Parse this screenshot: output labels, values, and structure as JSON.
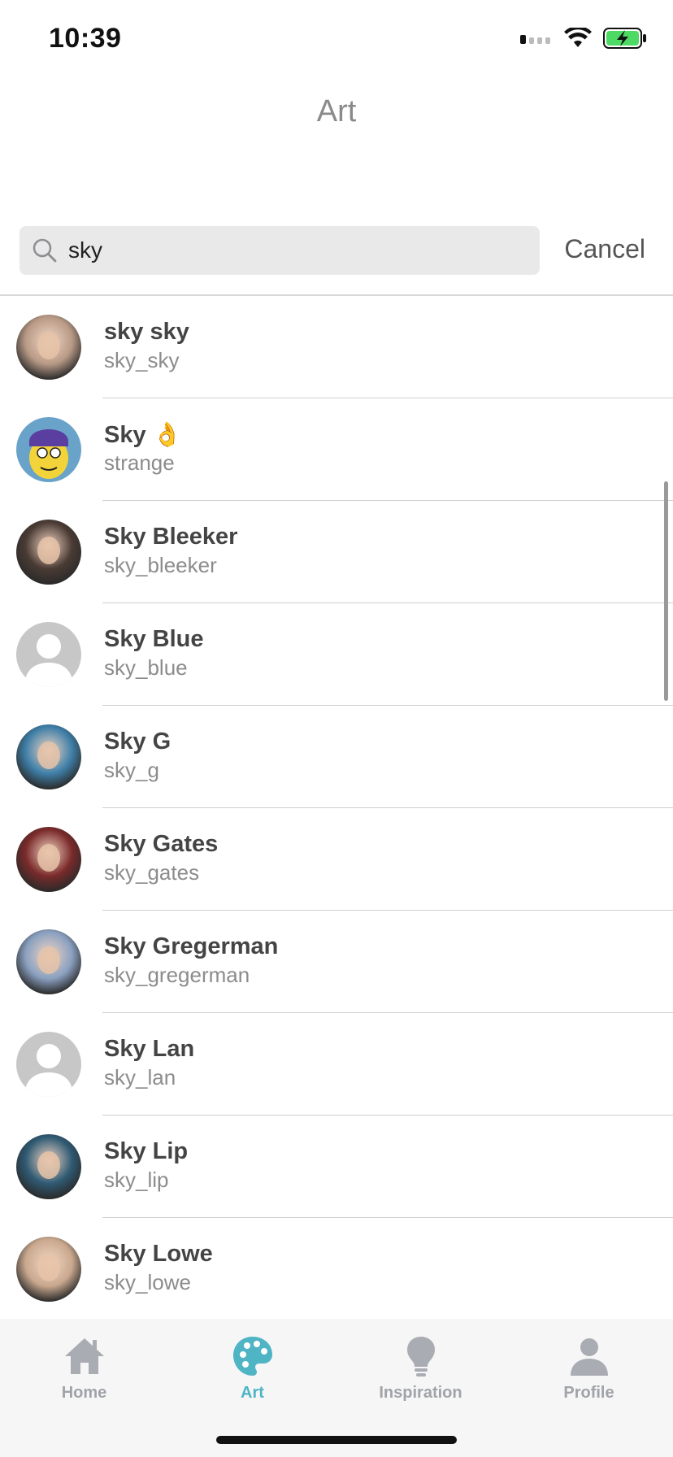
{
  "status_bar": {
    "time": "10:39"
  },
  "nav": {
    "title": "Art"
  },
  "search": {
    "query": "sky",
    "cancel_label": "Cancel"
  },
  "results": [
    {
      "name": "sky sky",
      "username": "sky_sky",
      "avatar": "photo",
      "avatar_color": "#b89a86"
    },
    {
      "name": "Sky 👌",
      "username": "strange",
      "avatar": "cartoon",
      "avatar_color": "#f2d33a"
    },
    {
      "name": "Sky Bleeker",
      "username": "sky_bleeker",
      "avatar": "photo",
      "avatar_color": "#4a3b34"
    },
    {
      "name": "Sky Blue",
      "username": "sky_blue",
      "avatar": "default",
      "avatar_color": "#c7c7c7"
    },
    {
      "name": "Sky G",
      "username": "sky_g",
      "avatar": "photo",
      "avatar_color": "#3f7fa8"
    },
    {
      "name": "Sky Gates",
      "username": "sky_gates",
      "avatar": "photo",
      "avatar_color": "#7a2a2a"
    },
    {
      "name": "Sky Gregerman",
      "username": "sky_gregerman",
      "avatar": "photo",
      "avatar_color": "#8aa0c0"
    },
    {
      "name": "Sky Lan",
      "username": "sky_lan",
      "avatar": "default",
      "avatar_color": "#c7c7c7"
    },
    {
      "name": "Sky Lip",
      "username": "sky_lip",
      "avatar": "photo",
      "avatar_color": "#2f5a73"
    },
    {
      "name": "Sky Lowe",
      "username": "sky_lowe",
      "avatar": "photo",
      "avatar_color": "#c9a88e"
    }
  ],
  "tab_bar": {
    "items": [
      {
        "label": "Home",
        "icon": "home-icon",
        "active": false
      },
      {
        "label": "Art",
        "icon": "palette-icon",
        "active": true
      },
      {
        "label": "Inspiration",
        "icon": "lightbulb-icon",
        "active": false
      },
      {
        "label": "Profile",
        "icon": "person-icon",
        "active": false
      }
    ]
  },
  "colors": {
    "accent": "#4fb4c4",
    "tab_inactive": "#a0a3a8",
    "battery": "#4cd964"
  }
}
